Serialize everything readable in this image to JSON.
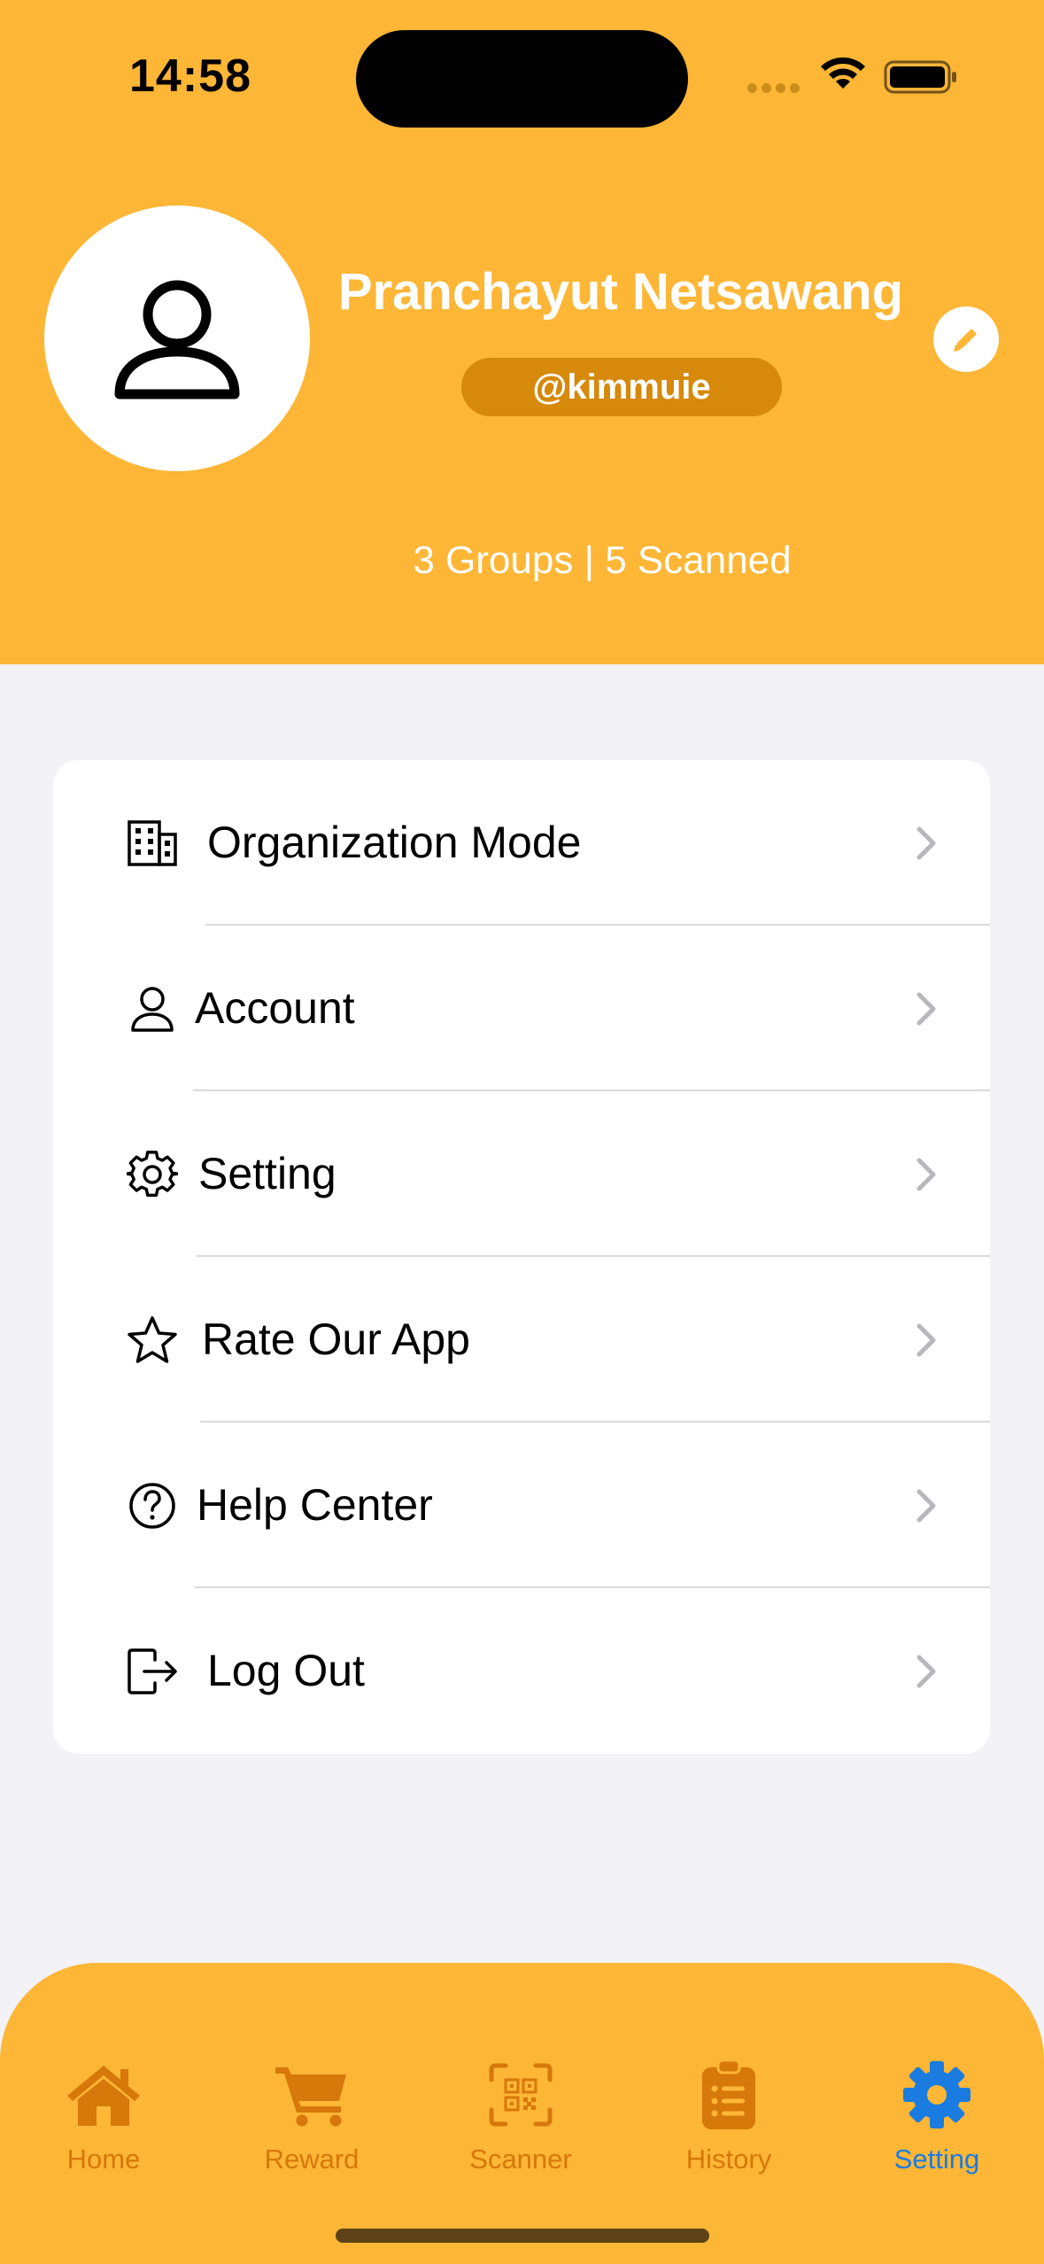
{
  "status_bar": {
    "time": "14:58"
  },
  "profile": {
    "name": "Pranchayut Netsawang",
    "handle": "@kimmuie",
    "stats": "3 Groups | 5 Scanned"
  },
  "menu": [
    {
      "label": "Organization Mode",
      "icon": "building-icon"
    },
    {
      "label": "Account",
      "icon": "person-icon"
    },
    {
      "label": "Setting",
      "icon": "gear-icon"
    },
    {
      "label": "Rate Our App",
      "icon": "star-icon"
    },
    {
      "label": "Help Center",
      "icon": "question-circle-icon"
    },
    {
      "label": "Log Out",
      "icon": "logout-icon"
    }
  ],
  "tabs": [
    {
      "label": "Home",
      "icon": "house-icon"
    },
    {
      "label": "Reward",
      "icon": "cart-icon"
    },
    {
      "label": "Scanner",
      "icon": "qr-scanner-icon"
    },
    {
      "label": "History",
      "icon": "clipboard-list-icon"
    },
    {
      "label": "Setting",
      "icon": "gear-icon",
      "active": true
    }
  ],
  "colors": {
    "brand": "#FDB636",
    "handle_pill": "#D6890A",
    "tab_inactive": "#D6780A",
    "tab_active": "#1A7CE0",
    "background": "#F2F2F7"
  }
}
